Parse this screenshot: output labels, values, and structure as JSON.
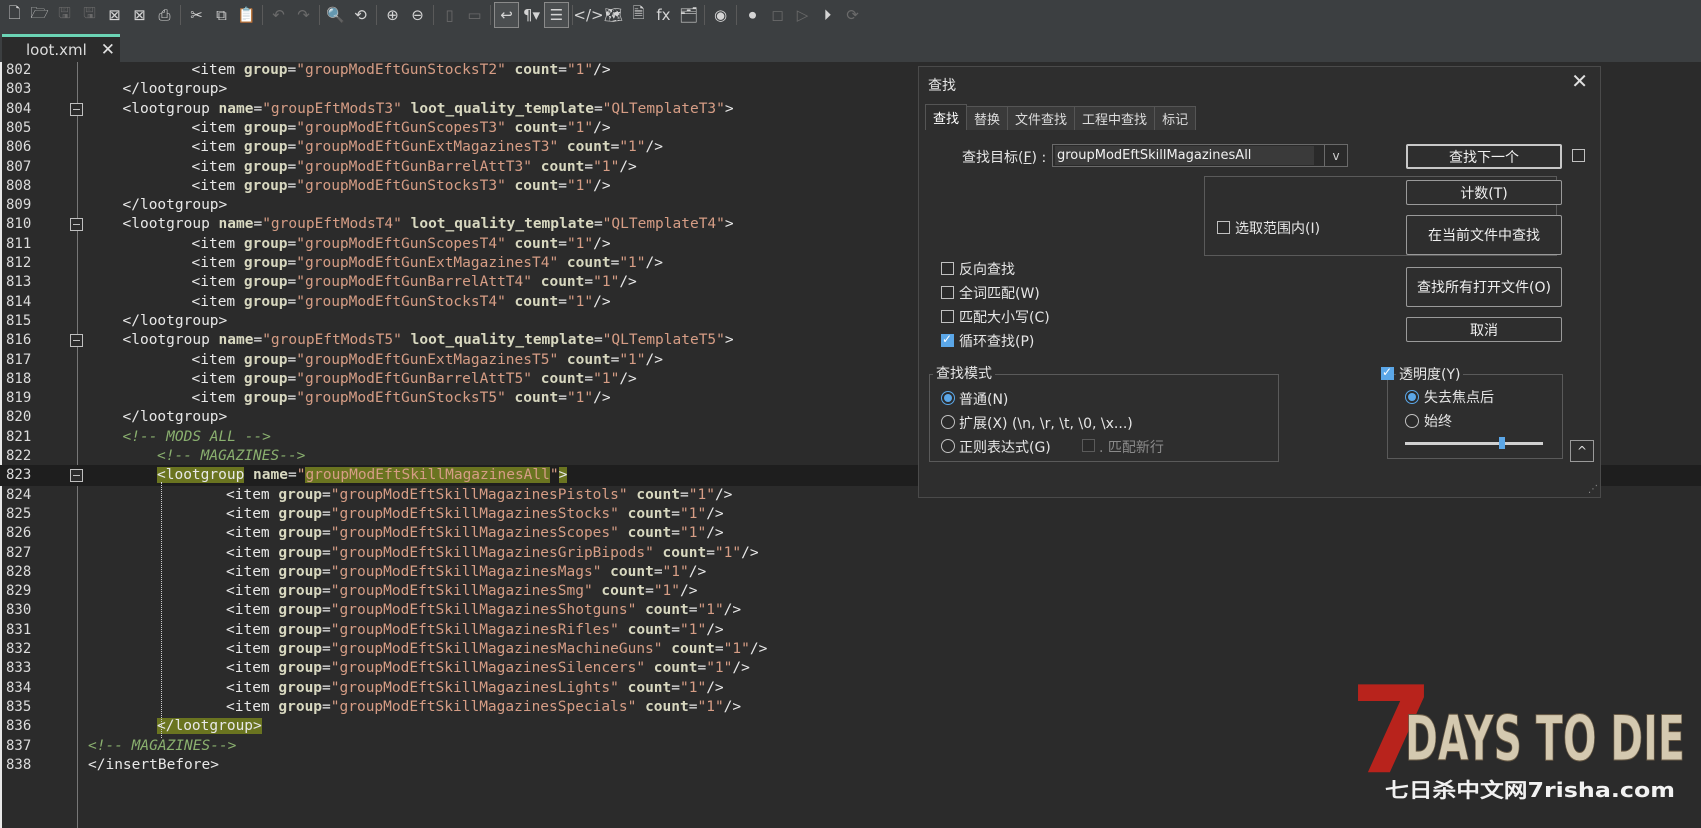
{
  "toolbar": {
    "icons": [
      "new-file-icon",
      "open-file-icon",
      "save-icon",
      "save-all-icon",
      "close-icon",
      "close-all-icon",
      "print-icon",
      "cut-icon",
      "copy-icon",
      "paste-icon",
      "undo-icon",
      "redo-icon",
      "find-icon",
      "replace-icon",
      "zoom-in-icon",
      "zoom-out-icon",
      "sync-vertical-icon",
      "sync-horizontal-icon",
      "word-wrap-icon",
      "show-all-chars-icon",
      "indent-guide-icon",
      "xml-tag-icon",
      "doc-map-icon",
      "doc-list-icon",
      "function-list-icon",
      "folder-workspace-icon",
      "monitoring-icon",
      "record-macro-icon",
      "stop-record-icon",
      "play-macro-icon",
      "run-macro-icon",
      "save-macro-icon"
    ]
  },
  "tab": {
    "name": "loot.xml",
    "close": "✕"
  },
  "editor": {
    "lines": [
      {
        "n": "802",
        "indent": 4,
        "kind": "item",
        "group": "groupModEftGunStocksT2",
        "count": "1"
      },
      {
        "n": "803",
        "indent": 2,
        "kind": "close",
        "text": "</lootgroup>"
      },
      {
        "n": "804",
        "indent": 2,
        "kind": "lootgroup",
        "name": "groupEftModsT3",
        "tpl": "QLTemplateT3",
        "fold": true
      },
      {
        "n": "805",
        "indent": 4,
        "kind": "item",
        "group": "groupModEftGunScopesT3",
        "count": "1"
      },
      {
        "n": "806",
        "indent": 4,
        "kind": "item",
        "group": "groupModEftGunExtMagazinesT3",
        "count": "1"
      },
      {
        "n": "807",
        "indent": 4,
        "kind": "item",
        "group": "groupModEftGunBarrelAttT3",
        "count": "1"
      },
      {
        "n": "808",
        "indent": 4,
        "kind": "item",
        "group": "groupModEftGunStocksT3",
        "count": "1"
      },
      {
        "n": "809",
        "indent": 2,
        "kind": "close",
        "text": "</lootgroup>"
      },
      {
        "n": "810",
        "indent": 2,
        "kind": "lootgroup",
        "name": "groupEftModsT4",
        "tpl": "QLTemplateT4",
        "fold": true
      },
      {
        "n": "811",
        "indent": 4,
        "kind": "item",
        "group": "groupModEftGunScopesT4",
        "count": "1"
      },
      {
        "n": "812",
        "indent": 4,
        "kind": "item",
        "group": "groupModEftGunExtMagazinesT4",
        "count": "1"
      },
      {
        "n": "813",
        "indent": 4,
        "kind": "item",
        "group": "groupModEftGunBarrelAttT4",
        "count": "1"
      },
      {
        "n": "814",
        "indent": 4,
        "kind": "item",
        "group": "groupModEftGunStocksT4",
        "count": "1"
      },
      {
        "n": "815",
        "indent": 2,
        "kind": "close",
        "text": "</lootgroup>"
      },
      {
        "n": "816",
        "indent": 2,
        "kind": "lootgroup",
        "name": "groupEftModsT5",
        "tpl": "QLTemplateT5",
        "fold": true
      },
      {
        "n": "817",
        "indent": 4,
        "kind": "item",
        "group": "groupModEftGunExtMagazinesT5",
        "count": "1"
      },
      {
        "n": "818",
        "indent": 4,
        "kind": "item",
        "group": "groupModEftGunBarrelAttT5",
        "count": "1"
      },
      {
        "n": "819",
        "indent": 4,
        "kind": "item",
        "group": "groupModEftGunStocksT5",
        "count": "1"
      },
      {
        "n": "820",
        "indent": 2,
        "kind": "close",
        "text": "</lootgroup>"
      },
      {
        "n": "821",
        "indent": 2,
        "kind": "comment",
        "text": "<!-- MODS ALL -->"
      },
      {
        "n": "822",
        "indent": 3,
        "kind": "comment",
        "text": "<!-- MAGAZINES-->"
      },
      {
        "n": "823",
        "indent": 3,
        "kind": "lootgroup-hl",
        "name": "groupModEftSkillMagazinesAll",
        "fold": true,
        "current": true
      },
      {
        "n": "824",
        "indent": 5,
        "kind": "item",
        "group": "groupModEftSkillMagazinesPistols",
        "count": "1"
      },
      {
        "n": "825",
        "indent": 5,
        "kind": "item",
        "group": "groupModEftSkillMagazinesStocks",
        "count": "1"
      },
      {
        "n": "826",
        "indent": 5,
        "kind": "item",
        "group": "groupModEftSkillMagazinesScopes",
        "count": "1"
      },
      {
        "n": "827",
        "indent": 5,
        "kind": "item",
        "group": "groupModEftSkillMagazinesGripBipods",
        "count": "1"
      },
      {
        "n": "828",
        "indent": 5,
        "kind": "item",
        "group": "groupModEftSkillMagazinesMags",
        "count": "1"
      },
      {
        "n": "829",
        "indent": 5,
        "kind": "item",
        "group": "groupModEftSkillMagazinesSmg",
        "count": "1"
      },
      {
        "n": "830",
        "indent": 5,
        "kind": "item",
        "group": "groupModEftSkillMagazinesShotguns",
        "count": "1"
      },
      {
        "n": "831",
        "indent": 5,
        "kind": "item",
        "group": "groupModEftSkillMagazinesRifles",
        "count": "1"
      },
      {
        "n": "832",
        "indent": 5,
        "kind": "item",
        "group": "groupModEftSkillMagazinesMachineGuns",
        "count": "1"
      },
      {
        "n": "833",
        "indent": 5,
        "kind": "item",
        "group": "groupModEftSkillMagazinesSilencers",
        "count": "1"
      },
      {
        "n": "834",
        "indent": 5,
        "kind": "item",
        "group": "groupModEftSkillMagazinesLights",
        "count": "1"
      },
      {
        "n": "835",
        "indent": 5,
        "kind": "item",
        "group": "groupModEftSkillMagazinesSpecials",
        "count": "1"
      },
      {
        "n": "836",
        "indent": 3,
        "kind": "close-hl",
        "text": "</lootgroup>"
      },
      {
        "n": "837",
        "indent": 1,
        "kind": "comment",
        "text": "<!-- MAGAZINES-->"
      },
      {
        "n": "838",
        "indent": 1,
        "kind": "close",
        "text": "</insertBefore>"
      }
    ]
  },
  "dialog": {
    "title": "查找",
    "close": "✕",
    "tabs": [
      "查找",
      "替换",
      "文件查找",
      "工程中查找",
      "标记"
    ],
    "find_label_text": "查找目标(",
    "find_label_key": "F",
    "find_label_end": ") :",
    "find_value": "groupModEftSkillMagazinesAll",
    "combo_arrow": "v",
    "buttons": {
      "find_next": "查找下一个",
      "count": "计数(T)",
      "find_in_current": "在当前文件中查找",
      "find_all_open": "查找所有打开文件(O)",
      "cancel": "取消"
    },
    "in_selection": "选取范围内(I)",
    "options": [
      {
        "label": "反向查找",
        "checked": false
      },
      {
        "label": "全词匹配(W)",
        "checked": false
      },
      {
        "label": "匹配大小写(C)",
        "checked": false
      },
      {
        "label": "循环查找(P)",
        "checked": true
      }
    ],
    "search_mode": {
      "title": "查找模式",
      "normal": "普通(N)",
      "extended": "扩展(X) (\\n, \\r, \\t, \\0, \\x...)",
      "regex": "正则表达式(G)",
      "dot_newline": ". 匹配新行",
      "selected": "normal"
    },
    "transparency": {
      "label": "透明度(Y)",
      "enabled": true,
      "on_lose_focus": "失去焦点后",
      "always": "始终",
      "selected": "on_lose_focus",
      "level": 0.7
    },
    "collapse": "^"
  },
  "watermark": {
    "big": "DAYS TO DIE",
    "seven": "7",
    "small": "七日杀中文网7risha.com"
  },
  "colors": {
    "tag": "#e8e8e8",
    "attr": "#d8d8c0",
    "string": "#d69d85",
    "comment": "#8ab06f",
    "highlight": "#6a7420",
    "accent": "#5ba7e8",
    "tab_accent": "#6bd4b5"
  }
}
